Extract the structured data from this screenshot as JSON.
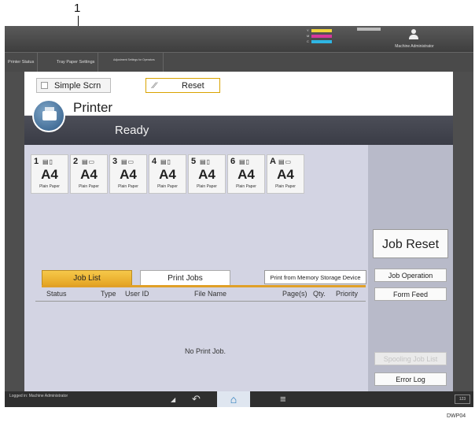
{
  "callout": {
    "number": "1"
  },
  "topbar": {
    "toner_labels": [
      "Y",
      "M",
      "C",
      "K"
    ],
    "toner_colors": {
      "Y": "#f0d43a",
      "M": "#d6379c",
      "C": "#2fb6e4",
      "K": "#bbbbbb"
    },
    "admin_label": "Machine Administrator"
  },
  "tabs": [
    {
      "label": "Printer Status"
    },
    {
      "label": "Tray Paper Settings"
    },
    {
      "label": "Adjustment Settings for Operators"
    }
  ],
  "toolbar": {
    "simple_label": "Simple Scrn",
    "reset_label": "Reset"
  },
  "printer": {
    "title": "Printer",
    "status": "Ready"
  },
  "trays": [
    {
      "num": "1",
      "size": "A4",
      "paper": "Plain Paper"
    },
    {
      "num": "2",
      "size": "A4",
      "paper": "Plain Paper"
    },
    {
      "num": "3",
      "size": "A4",
      "paper": "Plain Paper"
    },
    {
      "num": "4",
      "size": "A4",
      "paper": "Plain Paper"
    },
    {
      "num": "5",
      "size": "A4",
      "paper": "Plain Paper"
    },
    {
      "num": "6",
      "size": "A4",
      "paper": "Plain Paper"
    },
    {
      "num": "A",
      "size": "A4",
      "paper": "Plain Paper"
    }
  ],
  "side_buttons": {
    "job_reset": "Job Reset",
    "job_operation": "Job Operation",
    "form_feed": "Form Feed",
    "spooling_job_list": "Spooling Job List",
    "error_log": "Error Log"
  },
  "job_tabs": {
    "job_list": "Job List",
    "print_jobs": "Print Jobs",
    "print_from_memory": "Print from Memory Storage Device"
  },
  "columns": [
    "Status",
    "Type",
    "User ID",
    "File Name",
    "Page(s)",
    "Qty.",
    "Priority"
  ],
  "empty_message": "No Print Job.",
  "bottombar": {
    "logged_in": "Logged in: Machine Administrator",
    "counter": "123"
  },
  "figure_code": "DWP04"
}
